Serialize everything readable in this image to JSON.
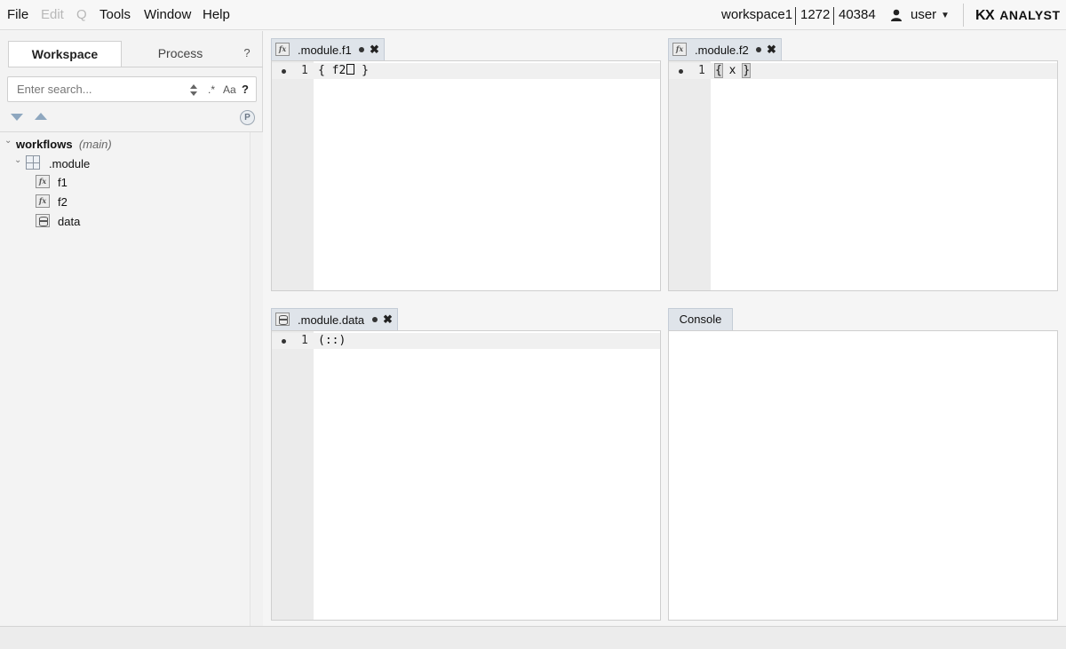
{
  "menu": {
    "file": "File",
    "edit": "Edit",
    "q": "Q",
    "tools": "Tools",
    "window": "Window",
    "help": "Help"
  },
  "status": {
    "workspace": "workspace1",
    "port": "1272",
    "pid": "40384",
    "user": "user",
    "brand_kx": "KX",
    "brand_name": "ANALYST"
  },
  "left_panel": {
    "tabs": {
      "workspace": "Workspace",
      "process": "Process",
      "help": "?"
    },
    "search": {
      "placeholder": "Enter search...",
      "regex": ".*",
      "case": "Aa",
      "help": "?"
    },
    "p_badge": "P",
    "tree": {
      "root": "workflows",
      "root_branch": "(main)",
      "module": ".module",
      "items": [
        {
          "label": "f1",
          "icon": "function-icon"
        },
        {
          "label": "f2",
          "icon": "function-icon"
        },
        {
          "label": "data",
          "icon": "data-icon"
        }
      ]
    }
  },
  "editors": {
    "f1": {
      "title": ".module.f1",
      "icon_text": "fx",
      "line_no": "1",
      "code_pre": "{ f2",
      "code_post": " }"
    },
    "f2": {
      "title": ".module.f2",
      "icon_text": "fx",
      "line_no": "1",
      "open_brace": "{",
      "code_mid": " x ",
      "close_brace": "}"
    },
    "data": {
      "title": ".module.data",
      "line_no": "1",
      "code": "(::)"
    }
  },
  "console": {
    "title": "Console"
  }
}
